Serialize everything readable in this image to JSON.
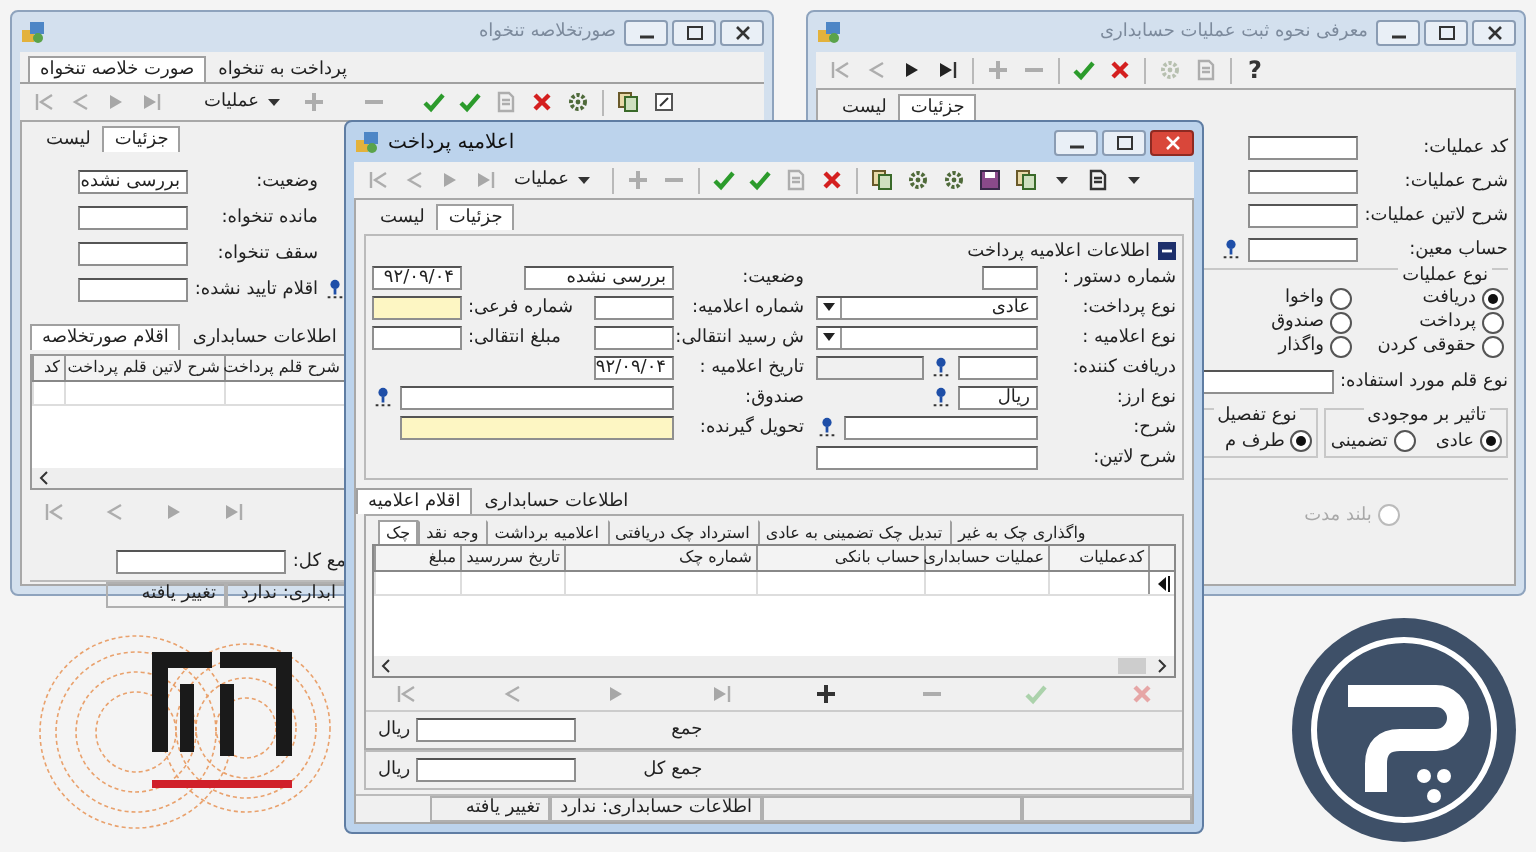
{
  "summary_window": {
    "title": "صورتخلاصه تنخواه",
    "tabs": [
      {
        "label": "پرداخت به تنخواه",
        "selected": false
      },
      {
        "label": "صورت خلاصه تنخواه",
        "selected": true
      }
    ],
    "toolbar_menu": "عملیات",
    "view_tabs": [
      {
        "label": "جزئیات",
        "selected": true
      },
      {
        "label": "لیست",
        "selected": false
      }
    ],
    "fields": [
      {
        "kind": "text",
        "label": "وضعیت:",
        "value": "بررسی نشده"
      },
      {
        "kind": "text",
        "label": "مانده تنخواه:"
      },
      {
        "kind": "text",
        "label": "سقف تنخواه:"
      },
      {
        "kind": "lookup",
        "label": "اقلام تایید نشده:"
      }
    ],
    "section_tabs": [
      {
        "label": "اطلاعات حسابداری",
        "selected": false
      },
      {
        "label": "اقلام صورتخلاصه",
        "selected": true
      }
    ],
    "table": {
      "columns": [
        "شرح قلم پرداخت",
        "شرح لاتین قلم پرداخت",
        "کد"
      ]
    },
    "total_label": "مع کل:",
    "status_bar": [
      "ابداری: ندارد",
      "تغییر یافته"
    ]
  },
  "operations_window": {
    "title": "معرفی نحوه ثبت عملیات حسابداری",
    "help": "?",
    "view_tabs": [
      {
        "label": "جزئیات",
        "selected": true
      },
      {
        "label": "لیست",
        "selected": false
      }
    ],
    "fields": [
      {
        "kind": "text",
        "label": "کد عملیات:"
      },
      {
        "kind": "text",
        "label": "شرح عملیات:"
      },
      {
        "kind": "text",
        "label": "شرح لاتین عملیات:"
      },
      {
        "kind": "lookup",
        "label": "حساب معین:"
      }
    ],
    "operation_type": {
      "title": "نوع عملیات",
      "options": [
        {
          "label": "دریافت",
          "selected": true
        },
        {
          "label": "پرداخت",
          "selected": false
        },
        {
          "label": "حقوقی کردن",
          "selected": false
        },
        {
          "label": "واخوا",
          "selected": false
        },
        {
          "label": "صندوق",
          "selected": false
        },
        {
          "label": "واگذار",
          "selected": false
        }
      ]
    },
    "item_type_label": "نوع قلم مورد استفاده:",
    "stock_effect": {
      "title": "تاثیر بر موجودی",
      "options": [
        {
          "label": "عادی",
          "selected": true
        },
        {
          "label": "تضمینی",
          "selected": false
        }
      ]
    },
    "detail_type": {
      "title": "نوع تفصیل",
      "options": [
        {
          "label": "طرف م",
          "selected": true
        }
      ]
    },
    "long_term": {
      "label": "بلند مدت",
      "selected": false,
      "disabled": true
    }
  },
  "payment_window": {
    "title": "اعلامیه پرداخت",
    "toolbar_menu": "عملیات",
    "view_tabs": [
      {
        "label": "جزئیات",
        "selected": true
      },
      {
        "label": "لیست",
        "selected": false
      }
    ],
    "info_group": {
      "title": "اطلاعات اعلامیه پرداخت",
      "expanded": true,
      "right_fields": [
        {
          "kind": "text",
          "label": "شماره دستور :"
        },
        {
          "kind": "dropdown",
          "label": "نوع پرداخت:",
          "value": "عادی"
        },
        {
          "kind": "dropdown",
          "label": "نوع اعلامیه :"
        },
        {
          "kind": "lookup_pair",
          "label": "دریافت کننده:"
        },
        {
          "kind": "lookup",
          "label": "نوع ارز:",
          "value": "ریال"
        },
        {
          "kind": "lookup_wide",
          "label": "شرح:"
        },
        {
          "kind": "wide",
          "label": "شرح لاتین:"
        }
      ],
      "left_fields": [
        {
          "kind": "status",
          "label": "وضعیت:",
          "value": "بررسی نشده",
          "required": false,
          "side": {
            "value": "۹۲/۰۹/۰۴",
            "required": false
          }
        },
        {
          "kind": "text",
          "label": "شماره اعلامیه:",
          "required": false,
          "side": {
            "label": "شماره فرعی:",
            "required": true
          }
        },
        {
          "kind": "text",
          "label": "ش رسید انتقالی:",
          "required": false,
          "side": {
            "label": "مبلغ انتقالی:",
            "required": false
          }
        },
        {
          "kind": "text",
          "label": "تاریخ اعلامیه :",
          "value": "۹۲/۰۹/۰۴",
          "required": false
        },
        {
          "kind": "lookup",
          "label": "صندوق:",
          "required": false
        },
        {
          "kind": "wide",
          "label": "تحویل گیرنده:",
          "required": true
        }
      ]
    },
    "section_tabs": [
      {
        "label": "اطلاعات حسابداری",
        "selected": false
      },
      {
        "label": "اقلام اعلامیه",
        "selected": true
      }
    ],
    "sub_tabs": [
      {
        "label": "واگذاری چک به غیر",
        "selected": false
      },
      {
        "label": "تبدیل چک تضمینی به عادی",
        "selected": false
      },
      {
        "label": "استرداد چک دریافتی",
        "selected": false
      },
      {
        "label": "اعلامیه برداشت",
        "selected": false
      },
      {
        "label": "وجه نقد",
        "selected": false
      },
      {
        "label": "چک",
        "selected": true
      }
    ],
    "table": {
      "columns": [
        "کدعملیات",
        "عملیات حسابداری",
        "حساب بانکی",
        "شماره چک",
        "تاریخ سررسید",
        "مبلغ"
      ]
    },
    "sum": {
      "label": "جمع",
      "currency": "ریال"
    },
    "grand_total": {
      "label": "جمع کل",
      "currency": "ریال"
    },
    "status_bar": [
      "اطلاعات حسابداری: ندارد",
      "تغییر یافته"
    ]
  }
}
